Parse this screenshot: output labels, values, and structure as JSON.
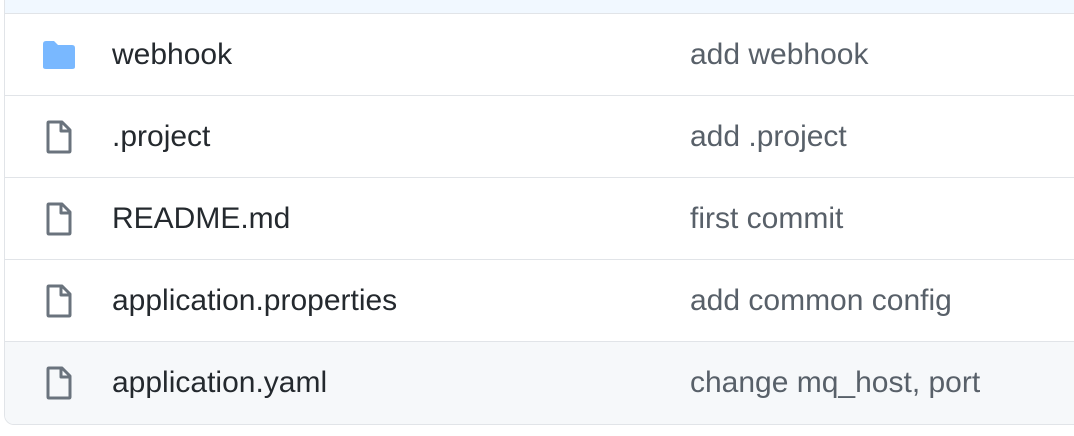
{
  "colors": {
    "folder": "#79b8ff",
    "file_icon": "#6a737d",
    "name_text": "#24292e",
    "message_text": "#586069",
    "border": "#e1e4e8",
    "hover_row": "#f6f8fa"
  },
  "files": [
    {
      "type": "folder",
      "icon": "folder-icon",
      "name": "webhook",
      "message": "add webhook"
    },
    {
      "type": "file",
      "icon": "file-icon",
      "name": ".project",
      "message": "add .project"
    },
    {
      "type": "file",
      "icon": "file-icon",
      "name": "README.md",
      "message": "first commit"
    },
    {
      "type": "file",
      "icon": "file-icon",
      "name": "application.properties",
      "message": "add common config"
    },
    {
      "type": "file",
      "icon": "file-icon",
      "name": "application.yaml",
      "message": "change mq_host, port"
    }
  ]
}
